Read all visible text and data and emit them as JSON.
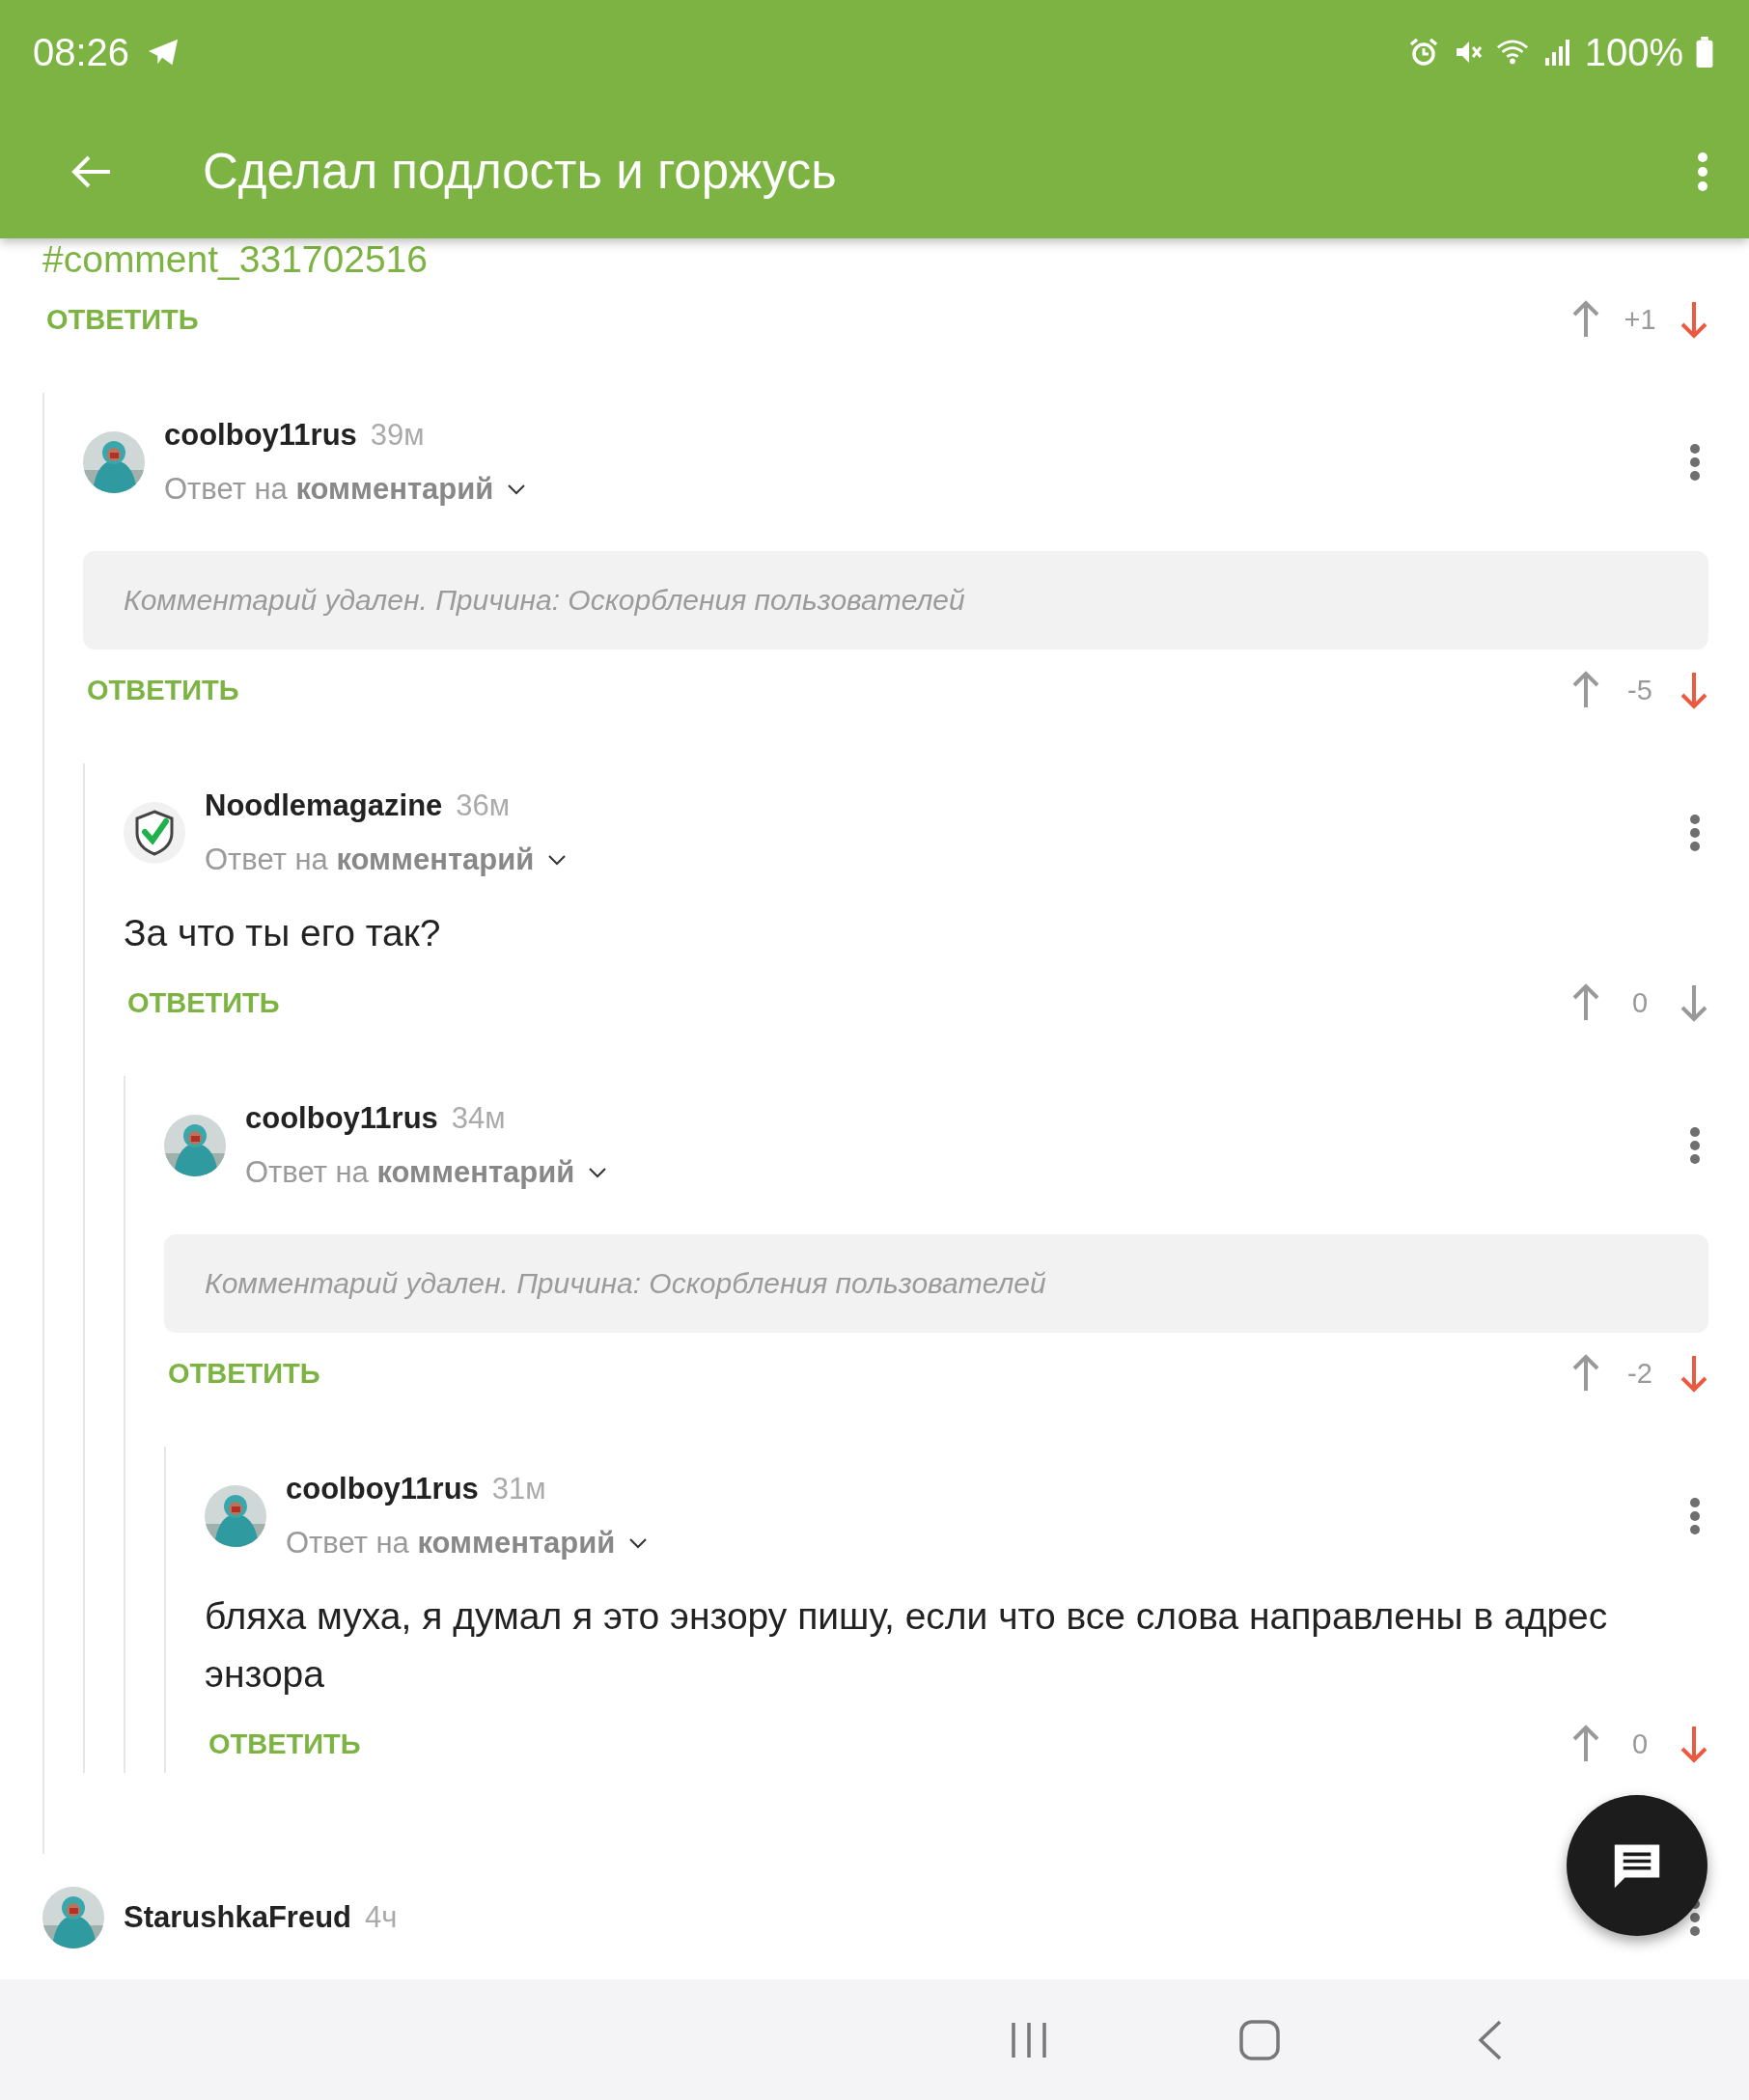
{
  "status_bar": {
    "time": "08:26",
    "battery": "100%"
  },
  "app_bar": {
    "title": "Сделал подлость и горжусь"
  },
  "comments": [
    {
      "kind": "link",
      "text": "#comment_331702516",
      "reply_label": "ОТВЕТИТЬ",
      "rating": "+1",
      "downvoted": true,
      "children": [
        {
          "author": "coolboy11rus",
          "time": "39м",
          "avatar": {
            "kind": "picture"
          },
          "reply_to": "Ответ на **комментарий**",
          "kind": "deleted",
          "text": "Комментарий удален. Причина: Оскорбления пользователей",
          "reply_label": "ОТВЕТИТЬ",
          "rating": "-5",
          "downvoted": true,
          "children": [
            {
              "author": "Noodlemagazine",
              "time": "36м",
              "avatar": {
                "kind": "shield"
              },
              "reply_to": "Ответ на **комментарий**",
              "kind": "text",
              "text": "За что ты его так?",
              "reply_label": "ОТВЕТИТЬ",
              "rating": "0",
              "downvoted": false,
              "children": [
                {
                  "author": "coolboy11rus",
                  "time": "34м",
                  "avatar": {
                    "kind": "picture"
                  },
                  "reply_to": "Ответ на **комментарий**",
                  "kind": "deleted",
                  "text": "Комментарий удален. Причина: Оскорбления пользователей",
                  "reply_label": "ОТВЕТИТЬ",
                  "rating": "-2",
                  "downvoted": true,
                  "children": [
                    {
                      "author": "coolboy11rus",
                      "time": "31м",
                      "avatar": {
                        "kind": "picture"
                      },
                      "reply_to": "Ответ на **комментарий**",
                      "kind": "text",
                      "text": "бляха муха, я думал я это энзору пишу, если что все слова направлены в адрес энзора",
                      "reply_label": "ОТВЕТИТЬ",
                      "rating": "0",
                      "downvoted": true
                    }
                  ]
                }
              ]
            }
          ]
        }
      ]
    },
    {
      "author": "StarushkaFreud",
      "time": "4ч",
      "avatar": {
        "kind": "picture"
      }
    }
  ]
}
